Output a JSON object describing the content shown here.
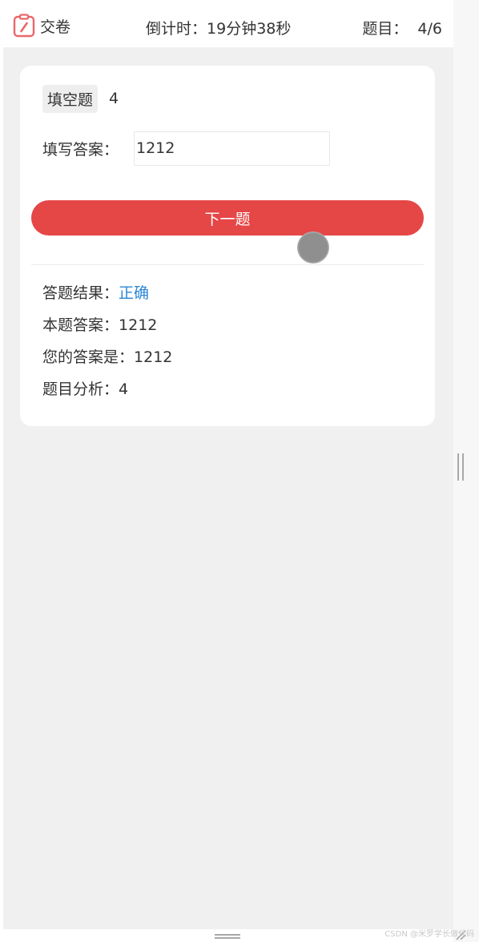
{
  "header": {
    "submit_label": "交卷",
    "timer_label": "倒计时：",
    "timer_value": "19分钟38秒",
    "progress_label": "题目：",
    "progress_value": "4/6"
  },
  "question": {
    "type_tag": "填空题",
    "text": "4"
  },
  "answer": {
    "label": "填写答案：",
    "value": "1212"
  },
  "next_button_label": "下一题",
  "result": {
    "outcome_label": "答题结果：",
    "outcome_value": "正确",
    "correct_answer_label": "本题答案：",
    "correct_answer_value": "1212",
    "your_answer_label": "您的答案是：",
    "your_answer_value": "1212",
    "analysis_label": "题目分析：",
    "analysis_value": "4"
  },
  "watermark": "CSDN @米罗学长做代码",
  "colors": {
    "accent_red": "#e54646",
    "correct_blue": "#2b86d6",
    "background": "#f0f0f0"
  },
  "icons": {
    "submit": "clipboard-pen-icon"
  }
}
